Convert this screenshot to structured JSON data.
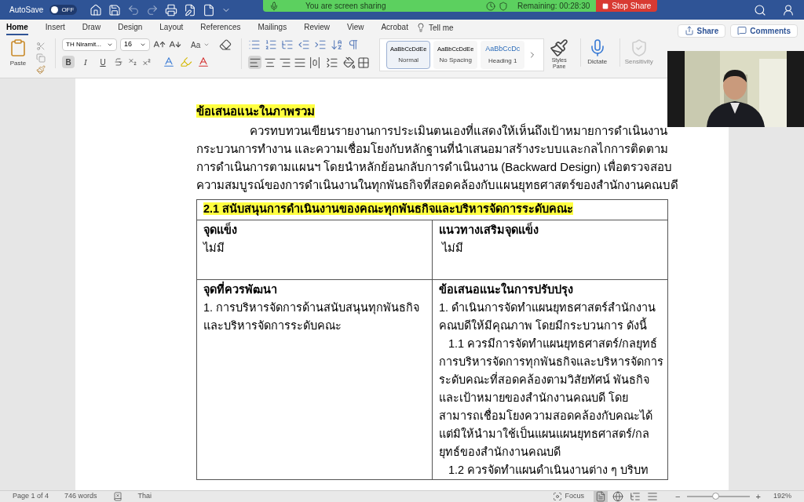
{
  "title_bar": {
    "autosave_label": "AutoSave",
    "autosave": {
      "on": false,
      "state_label": "OFF"
    }
  },
  "screen_share": {
    "status": "You are screen sharing",
    "remaining": "Remaining: 00:28:30",
    "stop": "Stop Share"
  },
  "ribbon_tabs": [
    {
      "label": "Home",
      "selected": true
    },
    {
      "label": "Insert",
      "selected": false
    },
    {
      "label": "Draw",
      "selected": false
    },
    {
      "label": "Design",
      "selected": false
    },
    {
      "label": "Layout",
      "selected": false
    },
    {
      "label": "References",
      "selected": false
    },
    {
      "label": "Mailings",
      "selected": false
    },
    {
      "label": "Review",
      "selected": false
    },
    {
      "label": "View",
      "selected": false
    },
    {
      "label": "Acrobat",
      "selected": false
    }
  ],
  "tell_me": "Tell me",
  "ribbon": {
    "paste": "Paste",
    "font_name": "TH Niramit...",
    "font_size": "16",
    "change_case": "Aa",
    "format_buttons": [
      {
        "kind": "bold",
        "label": "B",
        "selected": true
      },
      {
        "kind": "italic",
        "label": "I",
        "selected": false
      },
      {
        "kind": "underline",
        "label": "U",
        "selected": false
      }
    ],
    "alignment": [
      {
        "kind": "left",
        "selected": true
      },
      {
        "kind": "center",
        "selected": false
      },
      {
        "kind": "right",
        "selected": false
      },
      {
        "kind": "justify",
        "selected": false
      },
      {
        "kind": "distributed",
        "selected": false
      }
    ],
    "styles": [
      {
        "preview": "AaBbCcDdEe",
        "name": "Normal",
        "selected": true,
        "kind": "plain"
      },
      {
        "preview": "AaBbCcDdEe",
        "name": "No Spacing",
        "selected": false,
        "kind": "plain"
      },
      {
        "preview": "AaBbCcDc",
        "name": "Heading 1",
        "selected": false,
        "kind": "heading"
      }
    ],
    "styles_pane": "Styles Pane",
    "dictate": "Dictate",
    "sensitivity": {
      "label": "Sensitivity",
      "disabled": true
    }
  },
  "share": "Share",
  "comments": "Comments",
  "document": {
    "heading": "ข้อเสนอแนะในภาพรวม",
    "paragraph": {
      "indented": true,
      "lines": [
        "ควรทบทวนเขียนรายงานการประเมินตนเองที่แสดงให้เห็นถึงเป้าหมายการดำเนินงาน",
        "กระบวนการทำงาน และความเชื่อมโยงกับหลักฐานที่นำเสนอมาสร้างระบบและกลไกการติดตาม",
        "การดำเนินการตามแผนฯ โดยนำหลักย้อนกลับการดำเนินงาน (Backward Design) เพื่อตรวจสอบ",
        "ความสมบูรณ์ของการดำเนินงานในทุกพันธกิจที่สอดคล้องกับแผนยุทธศาสตร์ของสำนักงานคณบดี"
      ]
    },
    "table": {
      "header": "2.1 สนับสนุนการดำเนินงานของคณะทุกพันธกิจและบริหารจัดการระดับคณะ",
      "rows": [
        [
          {
            "heading": "จุดแข็ง",
            "paragraphs": [
              {
                "indented": false,
                "lines": [
                  "ไม่มี"
                ]
              }
            ]
          },
          {
            "heading": "แนวทางเสริมจุดแข็ง",
            "paragraphs": [
              {
                "indented": false,
                "lines": [
                  " ไม่มี"
                ]
              }
            ]
          }
        ],
        [
          {
            "heading": "จุดที่ควรพัฒนา",
            "paragraphs": [
              {
                "indented": false,
                "lines": [
                  "1. การบริหารจัดการด้านสนับสนุนทุกพันธกิจ",
                  "และบริหารจัดการระดับคณะ"
                ]
              }
            ]
          },
          {
            "heading": "ข้อเสนอแนะในการปรับปรุง",
            "paragraphs": [
              {
                "indented": false,
                "lines": [
                  "1. ดำเนินการจัดทำแผนยุทธศาสตร์สำนักงาน",
                  "คณบดีให้มีคุณภาพ โดยมีกระบวนการ ดังนี้"
                ]
              },
              {
                "indented": true,
                "lines": [
                  "1.1 ควรมีการจัดทำแผนยุทธศาสตร์/กลยุทธ์",
                  "การบริหารจัดการทุกพันธกิจและบริหารจัดการ",
                  "ระดับคณะที่สอดคล้องตามวิสัยทัศน์ พันธกิจ",
                  "และเป้าหมายของสำนักงานคณบดี โดย",
                  "สามารถเชื่อมโยงความสอดคล้องกับคณะได้",
                  "แต่มิให้นำมาใช้เป็นแผนแผนยุทธศาสตร์/กล",
                  "ยุทธ์ของสำนักงานคณบดี"
                ]
              },
              {
                "indented": true,
                "lines": [
                  "1.2 ควรจัดทำแผนดำเนินงานต่าง ๆ บริบท"
                ]
              }
            ]
          }
        ]
      ]
    }
  },
  "status_bar": {
    "page": "Page 1 of 4",
    "words": "746 words",
    "language": "Thai",
    "focus": "Focus",
    "views": [
      {
        "kind": "print",
        "selected": true
      },
      {
        "kind": "web",
        "selected": false
      },
      {
        "kind": "outline",
        "selected": false
      },
      {
        "kind": "draft",
        "selected": false
      }
    ],
    "zoom_out": "−",
    "zoom": {
      "level": 0.45
    },
    "zoom_in": "+",
    "zoom_percent": "192%"
  }
}
